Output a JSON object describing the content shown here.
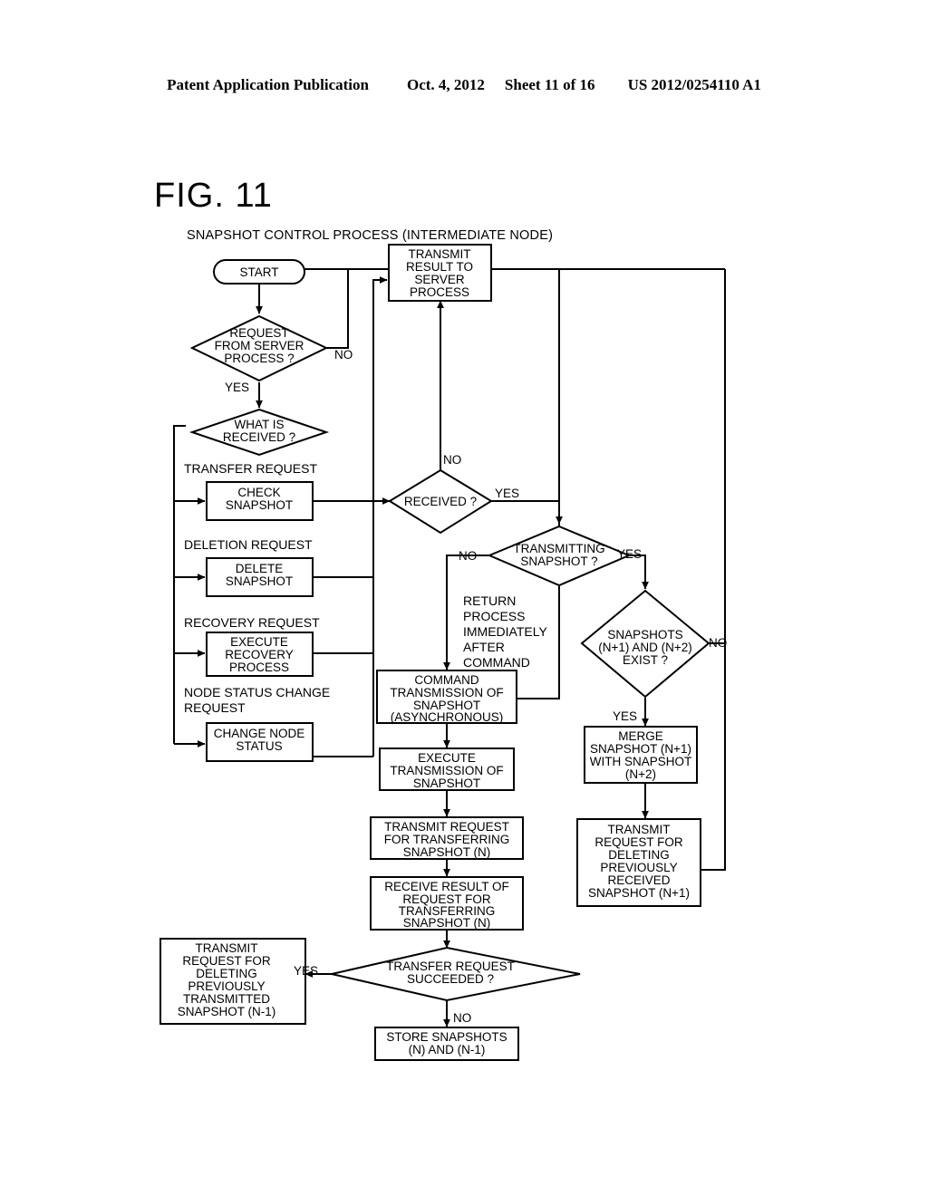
{
  "page_header": {
    "publication": "Patent Application Publication",
    "date": "Oct. 4, 2012",
    "sheet": "Sheet 11 of 16",
    "docnumber": "US 2012/0254110 A1"
  },
  "figure": {
    "number": "FIG. 11",
    "subtitle": "SNAPSHOT CONTROL PROCESS (INTERMEDIATE NODE)"
  },
  "nodes": {
    "start": {
      "type": "terminator",
      "lines": [
        "START"
      ]
    },
    "request_from_server": {
      "type": "decision",
      "lines": [
        "REQUEST",
        "FROM SERVER",
        "PROCESS ?"
      ]
    },
    "transmit_result": {
      "type": "process",
      "lines": [
        "TRANSMIT",
        "RESULT TO",
        "SERVER",
        "PROCESS"
      ]
    },
    "what_is_received": {
      "type": "decision",
      "lines": [
        "WHAT IS",
        "RECEIVED ?"
      ]
    },
    "check_snapshot": {
      "type": "process",
      "lines": [
        "CHECK",
        "SNAPSHOT"
      ]
    },
    "delete_snapshot": {
      "type": "process",
      "lines": [
        "DELETE",
        "SNAPSHOT"
      ]
    },
    "execute_recovery": {
      "type": "process",
      "lines": [
        "EXECUTE",
        "RECOVERY",
        "PROCESS"
      ]
    },
    "change_node_status": {
      "type": "process",
      "lines": [
        "CHANGE NODE",
        "STATUS"
      ]
    },
    "received": {
      "type": "decision",
      "lines": [
        "RECEIVED ?"
      ]
    },
    "transmitting_snapshot": {
      "type": "decision",
      "lines": [
        "TRANSMITTING",
        "SNAPSHOT ?"
      ]
    },
    "snapshots_exist": {
      "type": "decision",
      "lines": [
        "SNAPSHOTS",
        "(N+1) AND (N+2)",
        "EXIST ?"
      ]
    },
    "command_transmission": {
      "type": "process",
      "lines": [
        "COMMAND",
        "TRANSMISSION OF",
        "SNAPSHOT",
        "(ASYNCHRONOUS)"
      ]
    },
    "execute_transmission": {
      "type": "process",
      "lines": [
        "EXECUTE",
        "TRANSMISSION OF",
        "SNAPSHOT"
      ]
    },
    "transmit_request_transfer": {
      "type": "process",
      "lines": [
        "TRANSMIT REQUEST",
        "FOR TRANSFERRING",
        "SNAPSHOT (N)"
      ]
    },
    "receive_result": {
      "type": "process",
      "lines": [
        "RECEIVE RESULT OF",
        "REQUEST FOR",
        "TRANSFERRING",
        "SNAPSHOT (N)"
      ]
    },
    "merge_snapshot": {
      "type": "process",
      "lines": [
        "MERGE",
        "SNAPSHOT (N+1)",
        "WITH SNAPSHOT",
        "(N+2)"
      ]
    },
    "transmit_delete_received": {
      "type": "process",
      "lines": [
        "TRANSMIT",
        "REQUEST FOR",
        "DELETING",
        "PREVIOUSLY",
        "RECEIVED",
        "SNAPSHOT (N+1)"
      ]
    },
    "transfer_succeeded": {
      "type": "decision",
      "lines": [
        "TRANSFER REQUEST",
        "SUCCEEDED ?"
      ]
    },
    "transmit_delete_transmitted": {
      "type": "process",
      "lines": [
        "TRANSMIT",
        "REQUEST FOR",
        "DELETING",
        "PREVIOUSLY",
        "TRANSMITTED",
        "SNAPSHOT (N-1)"
      ]
    },
    "store_snapshots": {
      "type": "process",
      "lines": [
        "STORE SNAPSHOTS",
        "(N) AND (N-1)"
      ]
    }
  },
  "edge_labels": {
    "request_no": "NO",
    "request_yes": "YES",
    "branch_transfer": "TRANSFER REQUEST",
    "branch_deletion": "DELETION REQUEST",
    "branch_recovery": "RECOVERY REQUEST",
    "branch_node_status_1": "NODE STATUS CHANGE",
    "branch_node_status_2": "REQUEST",
    "received_no": "NO",
    "received_yes": "YES",
    "transmitting_no": "NO",
    "transmitting_yes": "YES",
    "snapshots_no": "NO",
    "snapshots_yes": "YES",
    "succeeded_yes": "YES",
    "succeeded_no": "NO",
    "note_return": [
      "RETURN",
      "PROCESS",
      "IMMEDIATELY",
      "AFTER",
      "COMMAND"
    ]
  },
  "colors": {
    "ink": "#000000",
    "paper": "#ffffff"
  }
}
